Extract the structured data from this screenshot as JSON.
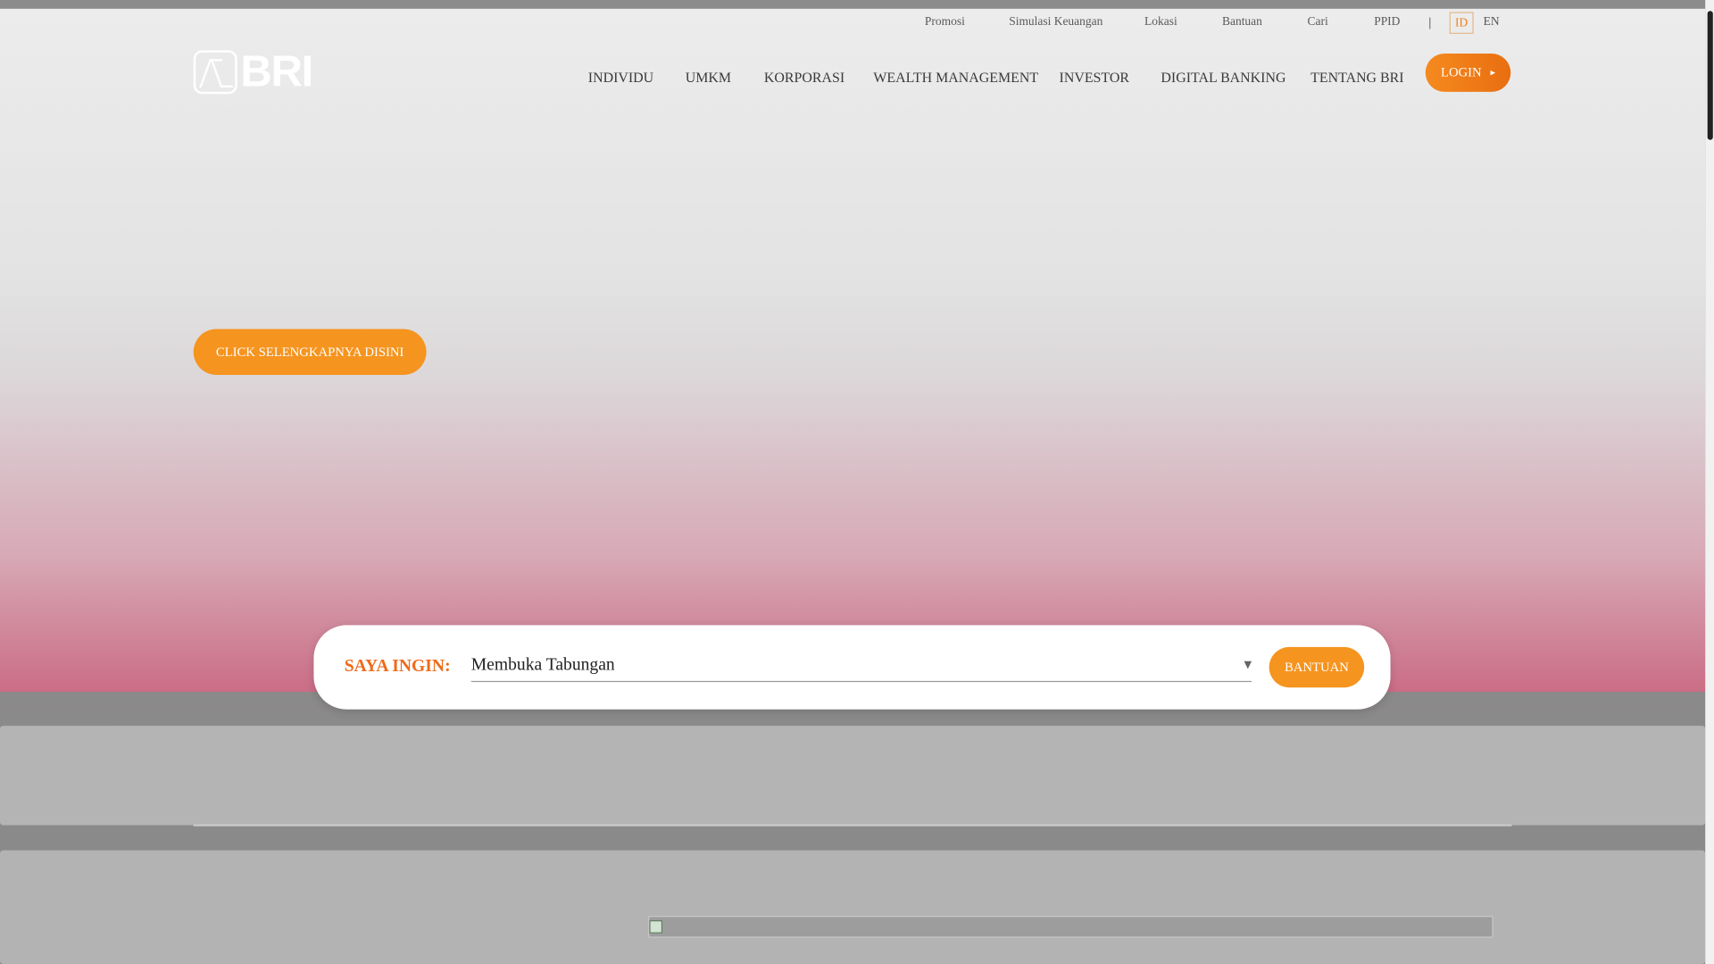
{
  "utility_nav": {
    "items": [
      {
        "label": "Promosi"
      },
      {
        "label": "Simulasi Keuangan"
      },
      {
        "label": "Lokasi"
      },
      {
        "label": "Bantuan"
      },
      {
        "label": "Cari"
      },
      {
        "label": "PPID"
      }
    ],
    "separator": "|",
    "languages": {
      "active": "ID",
      "other": "EN"
    }
  },
  "brand": {
    "logo_text": "BRI"
  },
  "main_nav": {
    "items": [
      {
        "label": "INDIVIDU"
      },
      {
        "label": "UMKM"
      },
      {
        "label": "KORPORASI"
      },
      {
        "label": "WEALTH MANAGEMENT"
      },
      {
        "label": "INVESTOR"
      },
      {
        "label": "DIGITAL BANKING"
      },
      {
        "label": "TENTANG BRI"
      }
    ],
    "login_label": "LOGIN",
    "login_icon": "chevron-right-icon"
  },
  "hero": {
    "cta_label": "CLICK SELENGKAPNYA DISINI"
  },
  "quick_search": {
    "label": "SAYA INGIN:",
    "selected_value": "Membuka Tabungan",
    "dropdown_icon": "chevron-down-icon",
    "button_label": "BANTUAN"
  },
  "colors": {
    "accent": "#F5941F",
    "label_orange": "#EF6A1A"
  }
}
